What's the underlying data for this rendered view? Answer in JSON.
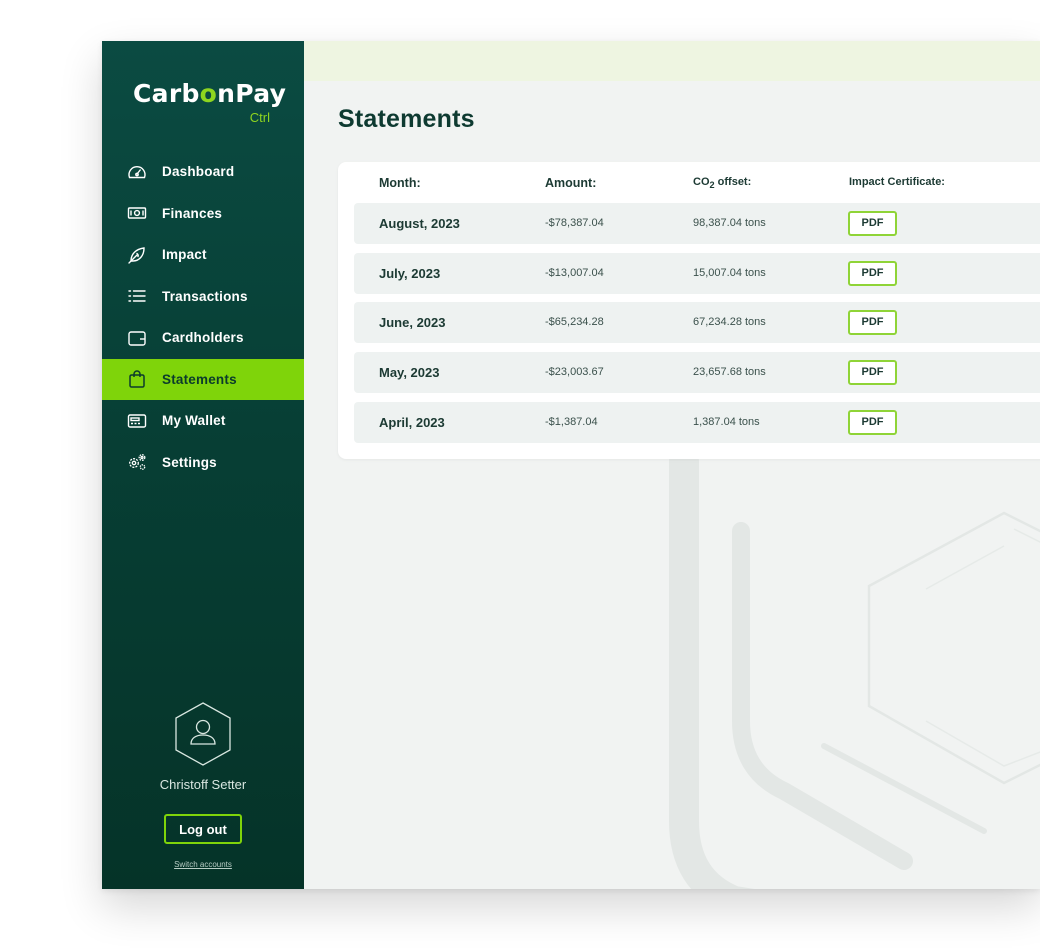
{
  "brand": {
    "name_part1": "Carb",
    "name_accent": "o",
    "name_part2": "nPay",
    "sub": "Ctrl",
    "accent_color": "#7fd40a",
    "sidebar_color": "#073f35"
  },
  "sidebar": {
    "items": [
      {
        "label": "Dashboard",
        "icon": "speedometer-icon",
        "active": false
      },
      {
        "label": "Finances",
        "icon": "banknote-icon",
        "active": false
      },
      {
        "label": "Impact",
        "icon": "leaf-icon",
        "active": false
      },
      {
        "label": "Transactions",
        "icon": "list-icon",
        "active": false
      },
      {
        "label": "Cardholders",
        "icon": "card-holder-icon",
        "active": false
      },
      {
        "label": "Statements",
        "icon": "shopping-bag-icon",
        "active": true
      },
      {
        "label": "My Wallet",
        "icon": "wallet-icon",
        "active": false
      },
      {
        "label": "Settings",
        "icon": "gears-icon",
        "active": false
      }
    ]
  },
  "user": {
    "name": "Christoff Setter",
    "logout_label": "Log out",
    "switch_label": "Switch accounts"
  },
  "page": {
    "title": "Statements"
  },
  "table": {
    "headers": {
      "month": "Month:",
      "amount": "Amount:",
      "offset_prefix": "CO",
      "offset_sub": "2",
      "offset_suffix": " offset:",
      "certificate": "Impact Certificate:"
    },
    "rows": [
      {
        "month": "August, 2023",
        "amount": "-$78,387.04",
        "offset": "98,387.04 tons",
        "certificate": "PDF"
      },
      {
        "month": "July, 2023",
        "amount": "-$13,007.04",
        "offset": "15,007.04 tons",
        "certificate": "PDF"
      },
      {
        "month": "June, 2023",
        "amount": "-$65,234.28",
        "offset": "67,234.28 tons",
        "certificate": "PDF"
      },
      {
        "month": "May, 2023",
        "amount": "-$23,003.67",
        "offset": "23,657.68 tons",
        "certificate": "PDF"
      },
      {
        "month": "April, 2023",
        "amount": "-$1,387.04",
        "offset": "1,387.04 tons",
        "certificate": "PDF"
      }
    ]
  }
}
